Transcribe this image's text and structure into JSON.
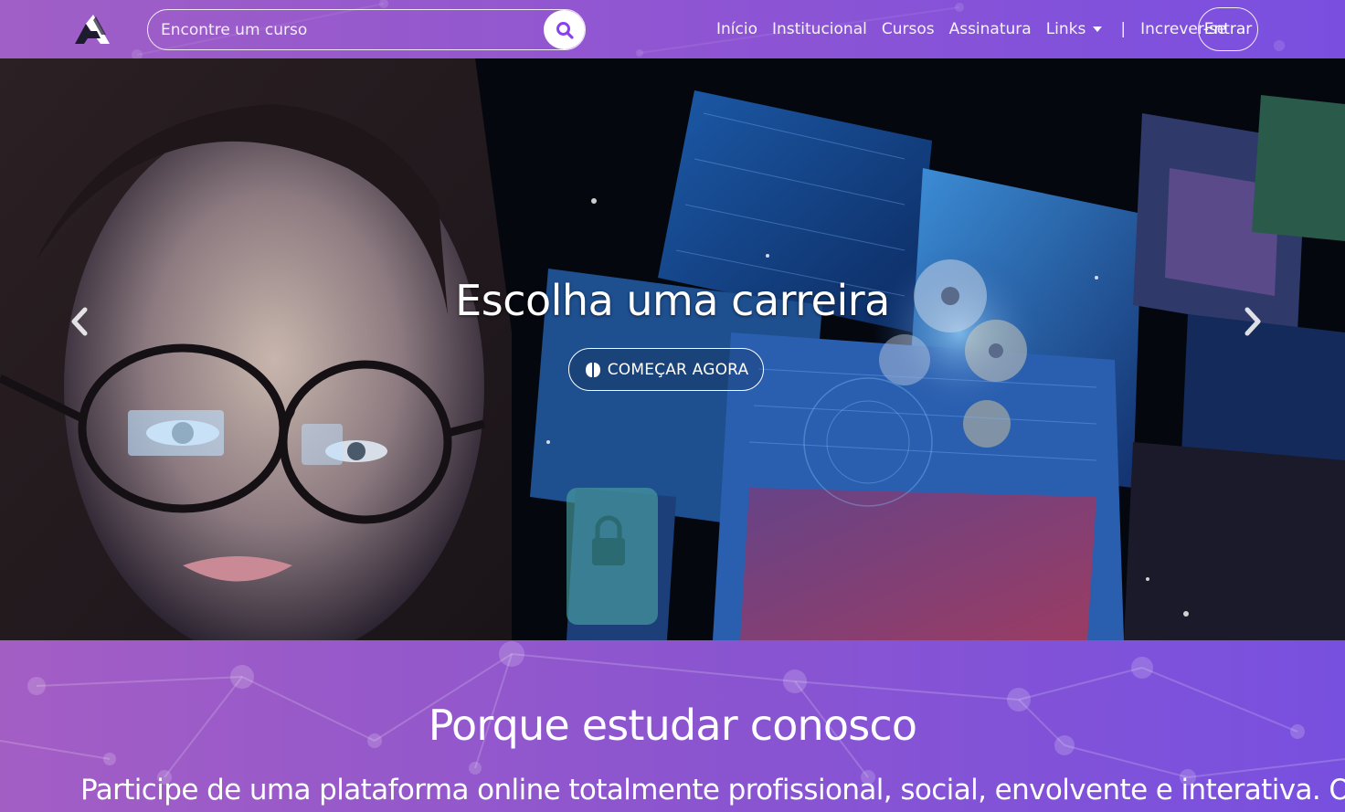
{
  "navbar": {
    "search": {
      "placeholder": "Encontre um curso"
    },
    "links": [
      "Início",
      "Institucional",
      "Cursos",
      "Assinatura"
    ],
    "links_dropdown_label": "Links",
    "separator": "|",
    "signup_label": "Increver-se",
    "login_label": "Entrar"
  },
  "hero": {
    "title": "Escolha uma carreira",
    "cta_label": "COMEÇAR AGORA"
  },
  "section": {
    "title": "Porque estudar conosco",
    "text": "Participe de uma plataforma online totalmente profissional, social, envolvente e interativa. Obtenha a"
  },
  "colors": {
    "nav_gradient_start": "#a05fc6",
    "nav_gradient_end": "#7a4fe0",
    "accent": "#8a3ff0"
  },
  "icons": {
    "logo": "brand-logo",
    "search": "search-icon",
    "dropdown": "caret-down-icon",
    "cta": "brain-icon",
    "prev": "chevron-left-icon",
    "next": "chevron-right-icon"
  }
}
